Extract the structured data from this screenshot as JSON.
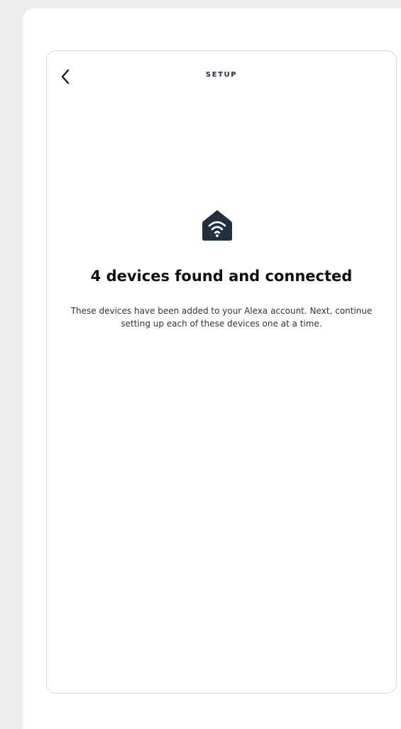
{
  "header": {
    "title": "SETUP",
    "back_icon": "chevron-left-icon"
  },
  "status": {
    "icon": "smart-home-wifi-icon",
    "heading": "4 devices found and connected",
    "description": "These devices have been added to your Alexa account. Next, continue setting up each of these devices one at a time."
  },
  "colors": {
    "background": "#ececec",
    "panel": "#ffffff",
    "frame_border": "#d6d6d6",
    "heading_text": "#0f1111",
    "icon_fill": "#232f3e"
  }
}
